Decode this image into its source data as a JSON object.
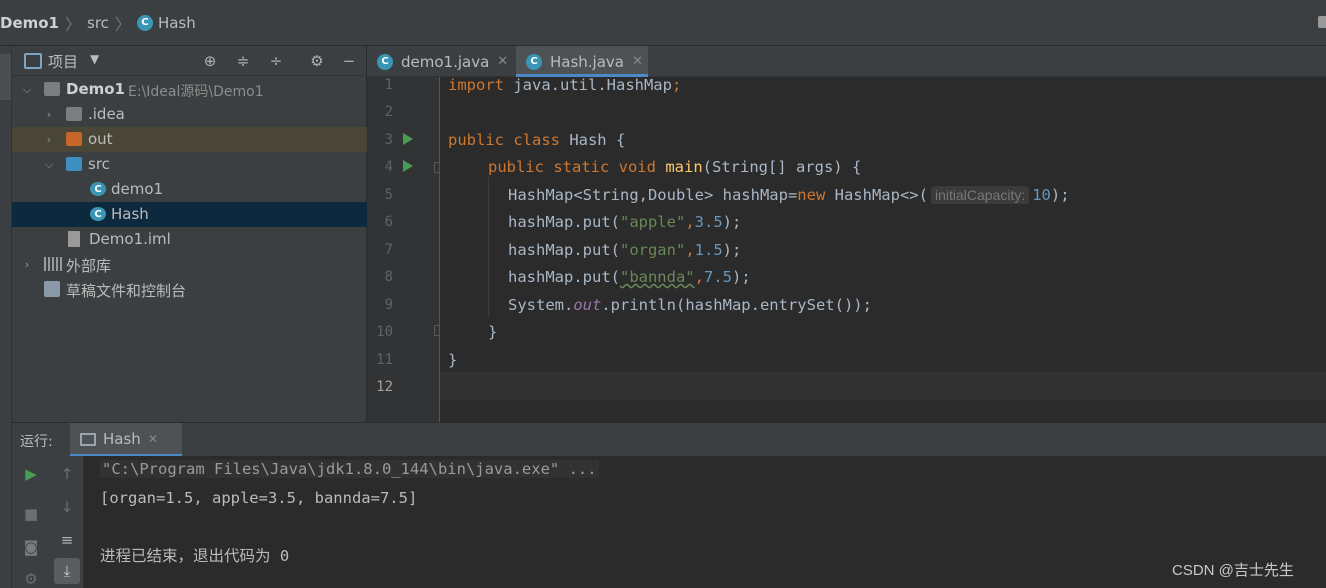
{
  "breadcrumb": {
    "project": "Demo1",
    "folder": "src",
    "file": "Hash"
  },
  "project_panel": {
    "title": "项目",
    "tree": [
      {
        "label": "Demo1",
        "path": "E:\\Ideal源码\\Demo1"
      },
      {
        "label": ".idea"
      },
      {
        "label": "out"
      },
      {
        "label": "src"
      },
      {
        "label": "demo1"
      },
      {
        "label": "Hash"
      },
      {
        "label": "Demo1.iml"
      },
      {
        "label": "外部库"
      },
      {
        "label": "草稿文件和控制台"
      }
    ]
  },
  "editor": {
    "tabs": [
      {
        "label": "demo1.java",
        "active": false
      },
      {
        "label": "Hash.java",
        "active": true
      }
    ],
    "line_numbers": [
      "1",
      "2",
      "3",
      "4",
      "5",
      "6",
      "7",
      "8",
      "9",
      "10",
      "11",
      "12"
    ],
    "code": {
      "l1_kw": "import",
      "l1_rest": " java.util.HashMap",
      "l1_semi": ";",
      "l3_kw": "public class",
      "l3_rest": " Hash {",
      "l4_kw": "public static void",
      "l4_fn": "main",
      "l4_rest": "(String[] args) {",
      "l5_a": "HashMap<String,Double> hashMap=",
      "l5_new": "new",
      "l5_b": " HashMap<>(",
      "l5_hint": "initialCapacity:",
      "l5_num": "10",
      "l5_c": ");",
      "l6_a": "hashMap.put(",
      "l6_str": "\"apple\"",
      "l6_comma": ",",
      "l6_num": "3.5",
      "l6_c": ");",
      "l7_a": "hashMap.put(",
      "l7_str": "\"organ\"",
      "l7_comma": ",",
      "l7_num": "1.5",
      "l7_c": ");",
      "l8_a": "hashMap.put(",
      "l8_str": "\"bannda\"",
      "l8_comma": ",",
      "l8_num": "7.5",
      "l8_c": ");",
      "l9_a": "System.",
      "l9_out": "out",
      "l9_b": ".println(hashMap.entrySet());",
      "l10": "}",
      "l11": "}"
    }
  },
  "run_panel": {
    "label": "运行:",
    "tab": "Hash",
    "console": [
      "\"C:\\Program Files\\Java\\jdk1.8.0_144\\bin\\java.exe\" ...",
      "[organ=1.5, apple=3.5, bannda=7.5]",
      "进程已结束，退出代码为 0"
    ],
    "watermark": "CSDN @吉士先生"
  },
  "colors": {
    "accent": "#4a88c7",
    "keyword": "#cc7832",
    "string": "#6a8759",
    "number": "#6897bb",
    "function": "#ffc66d"
  }
}
